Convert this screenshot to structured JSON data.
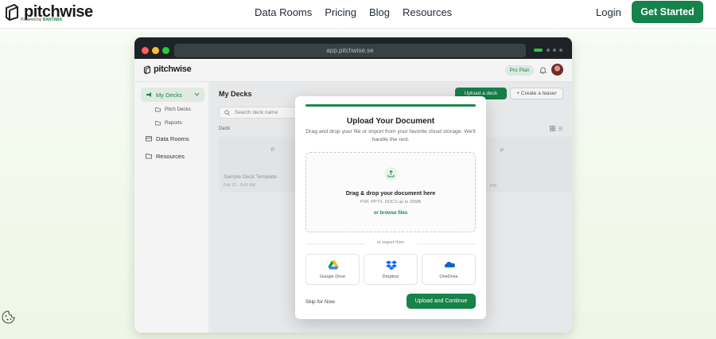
{
  "site": {
    "brand": "pitchwise",
    "brand_sub_prefix": "Powered by",
    "brand_sub_name": "BANTABA",
    "nav_links": [
      "Data Rooms",
      "Pricing",
      "Blog",
      "Resources"
    ],
    "login_label": "Login",
    "cta_label": "Get Started",
    "colors": {
      "brand_green": "#16834a",
      "accent_green": "#1c8a4f"
    }
  },
  "browser": {
    "url": "app.pitchwise.se"
  },
  "app": {
    "brand": "pitchwise",
    "plan_badge": "Pro Plan",
    "sidebar": {
      "items": [
        {
          "label": "My Decks",
          "icon": "megaphone-icon"
        },
        {
          "label": "Pitch Decks",
          "icon": "folder-icon"
        },
        {
          "label": "Reports",
          "icon": "folder-icon"
        },
        {
          "label": "Data Rooms",
          "icon": "database-icon"
        },
        {
          "label": "Resources",
          "icon": "folder-icon"
        }
      ]
    },
    "main": {
      "title": "My Decks",
      "upload_deck_label": "Upload a deck",
      "create_teaser_label": "+ Create a teaser",
      "search_placeholder": "Search deck name",
      "deck_column": "Deck",
      "card": {
        "thumb_letter": "P",
        "name": "Sample Deck Template",
        "date": "Feb 15 · 9:41 AM"
      },
      "card2_tail": "PM"
    }
  },
  "modal": {
    "title": "Upload Your Document",
    "description": "Drag and drop your file or import from your favorite cloud storage. We'll handle the rest.",
    "dropzone_title": "Drag & drop your document here",
    "dropzone_types": "PDF, PPTX, DOCX up to 25MB",
    "browse_label": "or browse files",
    "or_import": "or import from",
    "cloud_options": [
      "Google Drive",
      "Dropbox",
      "OneDrive"
    ],
    "skip_label": "Skip for Now",
    "continue_label": "Upload and Continue"
  }
}
